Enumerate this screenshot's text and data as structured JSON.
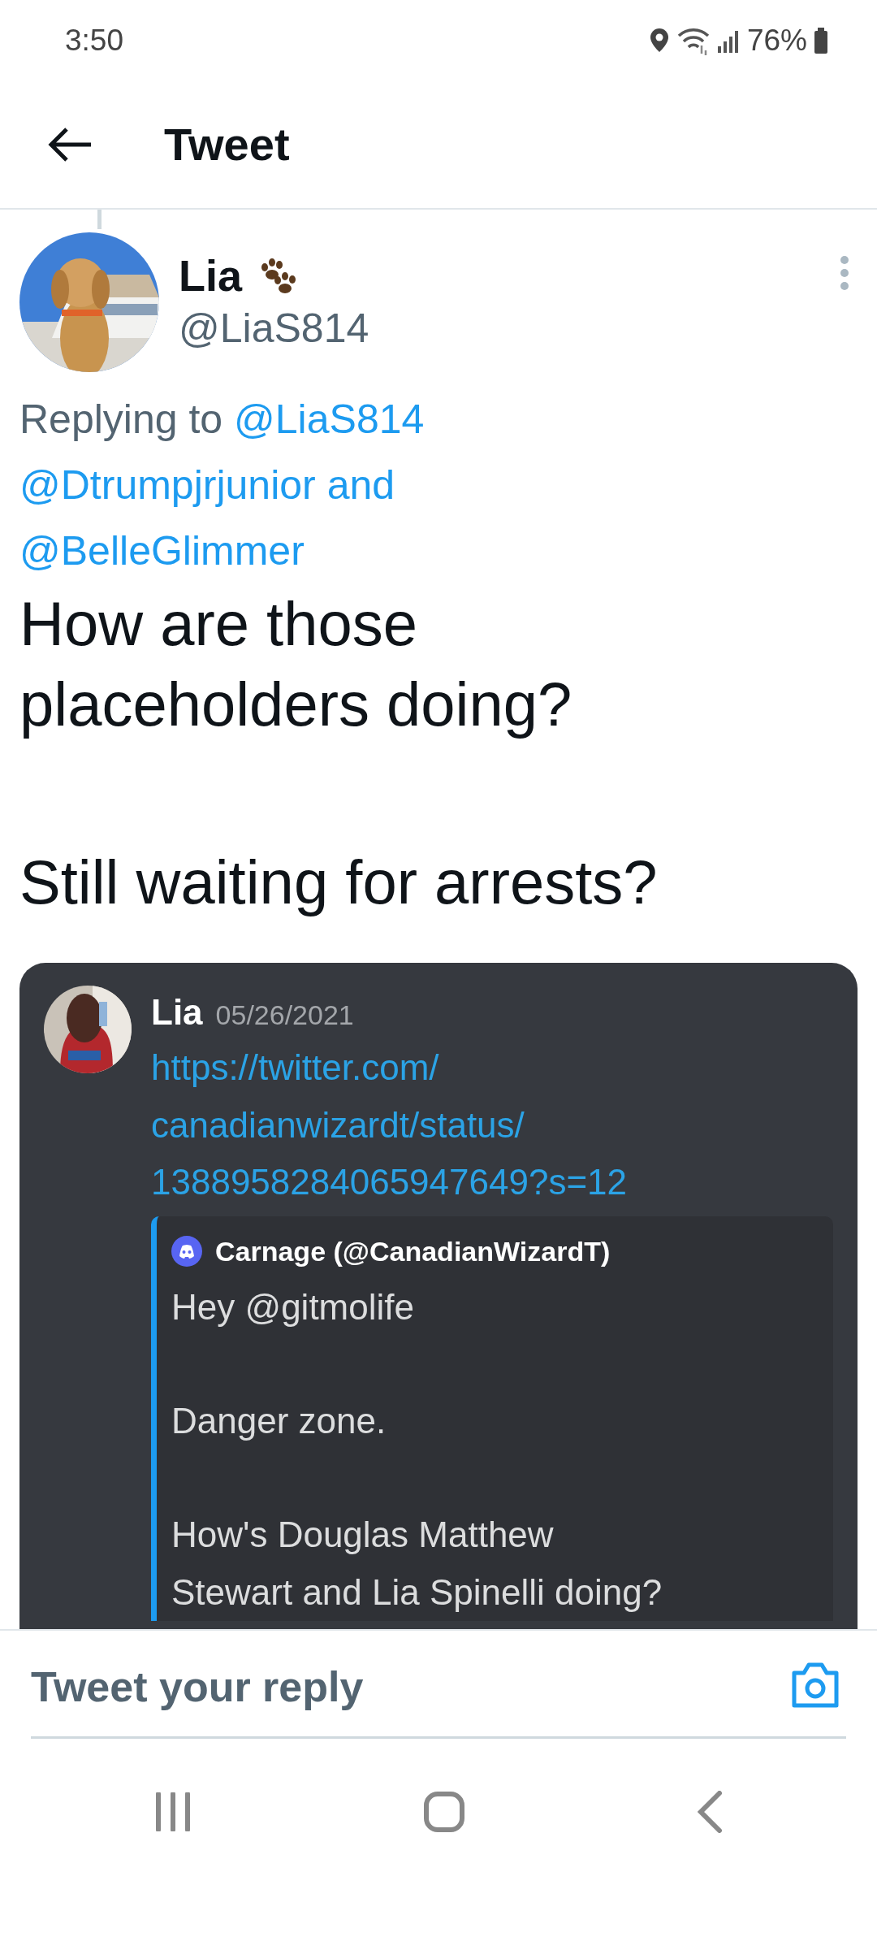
{
  "status_bar": {
    "time": "3:50",
    "battery": "76%"
  },
  "header": {
    "title": "Tweet"
  },
  "tweet": {
    "author": {
      "name": "Lia",
      "handle": "@LiaS814"
    },
    "replying_to": {
      "prefix": "Replying to",
      "mentions": [
        "@LiaS814",
        "@Dtrumpjrjunior",
        "@BelleGlimmer"
      ],
      "conjunction": "and"
    },
    "text": [
      "How are those placeholders doing?",
      "Still waiting for arrests?"
    ],
    "attachment": {
      "kind": "discord_screenshot",
      "author": "Lia",
      "date": "05/26/2021",
      "link_lines": [
        "https://twitter.com/",
        "canadianwizardt/status/",
        "1388958284065947649?s=12"
      ],
      "embed": {
        "author": "Carnage (@CanadianWizardT)",
        "paragraphs": [
          [
            "Hey @gitmolife"
          ],
          [
            "Danger zone."
          ],
          [
            "How's Douglas Matthew",
            "Stewart and Lia Spinelli doing?"
          ]
        ]
      }
    }
  },
  "reply": {
    "placeholder": "Tweet your reply"
  }
}
